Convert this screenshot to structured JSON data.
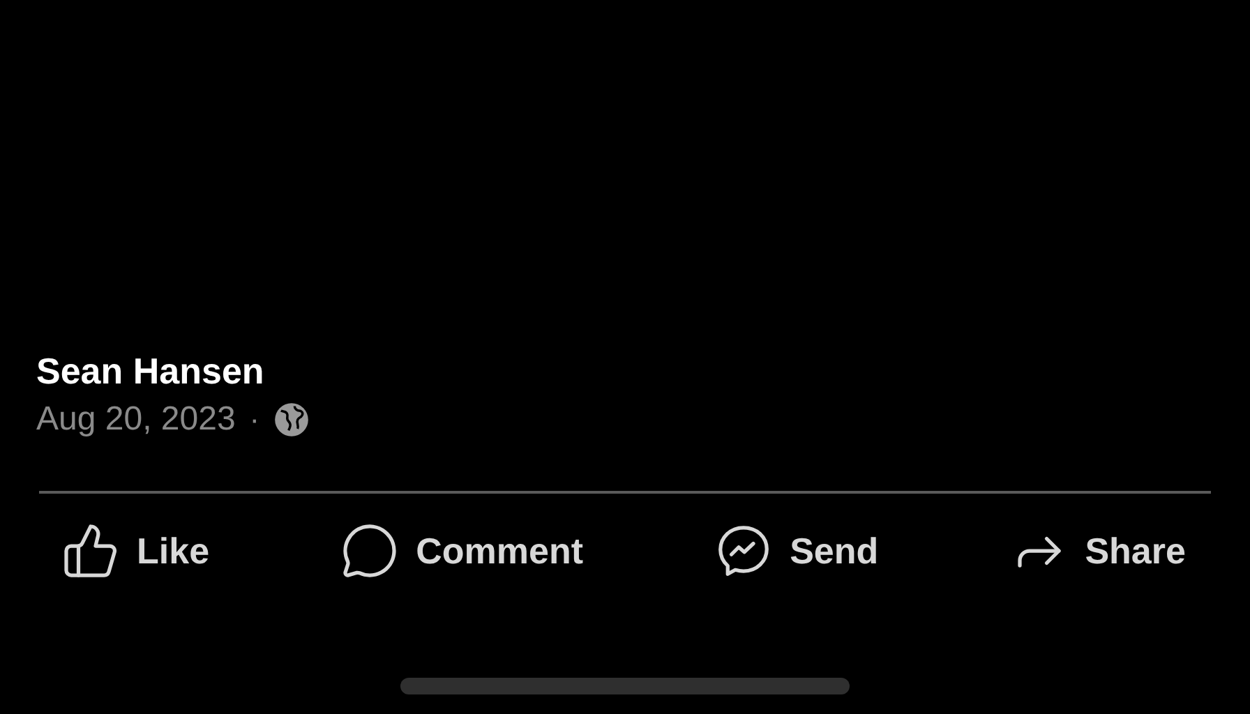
{
  "post": {
    "author": "Sean Hansen",
    "date": "Aug 20, 2023",
    "separator": "·"
  },
  "actions": [
    {
      "kind": "like",
      "label": "Like"
    },
    {
      "kind": "comment",
      "label": "Comment"
    },
    {
      "kind": "send",
      "label": "Send"
    },
    {
      "kind": "share",
      "label": "Share"
    }
  ]
}
